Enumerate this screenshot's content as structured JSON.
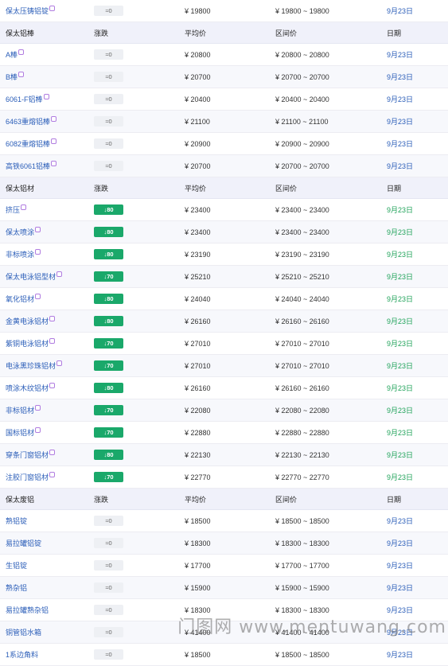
{
  "watermark": "门图网 www.mentuwang.com",
  "rows": [
    {
      "type": "data",
      "name": "保太压铸铝锭",
      "mark": true,
      "change": "0",
      "up": false,
      "avg": "¥  19800",
      "range": "¥  19800 ~ 19800",
      "date": "9月23日",
      "green": false
    },
    {
      "type": "head",
      "c1": "保太铝棒",
      "c2": "涨跌",
      "c3": "平均价",
      "c4": "区间价",
      "c5": "日期"
    },
    {
      "type": "data",
      "name": "A棒",
      "mark": true,
      "change": "0",
      "up": false,
      "avg": "¥  20800",
      "range": "¥  20800 ~ 20800",
      "date": "9月23日",
      "green": false
    },
    {
      "type": "data",
      "name": "B棒",
      "mark": true,
      "change": "0",
      "up": false,
      "avg": "¥  20700",
      "range": "¥  20700 ~ 20700",
      "date": "9月23日",
      "green": false
    },
    {
      "type": "data",
      "name": "6061-F铝棒",
      "mark": true,
      "change": "0",
      "up": false,
      "avg": "¥  20400",
      "range": "¥  20400 ~ 20400",
      "date": "9月23日",
      "green": false
    },
    {
      "type": "data",
      "name": "6463重熔铝棒",
      "mark": true,
      "change": "0",
      "up": false,
      "avg": "¥  21100",
      "range": "¥  21100 ~ 21100",
      "date": "9月23日",
      "green": false
    },
    {
      "type": "data",
      "name": "6082重熔铝棒",
      "mark": true,
      "change": "0",
      "up": false,
      "avg": "¥  20900",
      "range": "¥  20900 ~ 20900",
      "date": "9月23日",
      "green": false
    },
    {
      "type": "data",
      "name": "高铁6061铝棒",
      "mark": true,
      "change": "0",
      "up": false,
      "avg": "¥  20700",
      "range": "¥  20700 ~ 20700",
      "date": "9月23日",
      "green": false
    },
    {
      "type": "head",
      "c1": "保太铝材",
      "c2": "涨跌",
      "c3": "平均价",
      "c4": "区间价",
      "c5": "日期"
    },
    {
      "type": "data",
      "name": "挤压",
      "mark": true,
      "change": "80",
      "up": true,
      "avg": "¥  23400",
      "range": "¥  23400 ~ 23400",
      "date": "9月23日",
      "green": true
    },
    {
      "type": "data",
      "name": "保太喷涂",
      "mark": true,
      "change": "80",
      "up": true,
      "avg": "¥  23400",
      "range": "¥  23400 ~ 23400",
      "date": "9月23日",
      "green": true
    },
    {
      "type": "data",
      "name": "非标喷涂",
      "mark": true,
      "change": "80",
      "up": true,
      "avg": "¥  23190",
      "range": "¥  23190 ~ 23190",
      "date": "9月23日",
      "green": true
    },
    {
      "type": "data",
      "name": "保太电泳铝型材",
      "mark": true,
      "change": "70",
      "up": true,
      "avg": "¥  25210",
      "range": "¥  25210 ~ 25210",
      "date": "9月23日",
      "green": true
    },
    {
      "type": "data",
      "name": "氧化铝材",
      "mark": true,
      "change": "80",
      "up": true,
      "avg": "¥  24040",
      "range": "¥  24040 ~ 24040",
      "date": "9月23日",
      "green": true
    },
    {
      "type": "data",
      "name": "金黄电泳铝材",
      "mark": true,
      "change": "80",
      "up": true,
      "avg": "¥  26160",
      "range": "¥  26160 ~ 26160",
      "date": "9月23日",
      "green": true
    },
    {
      "type": "data",
      "name": "紫铜电泳铝材",
      "mark": true,
      "change": "70",
      "up": true,
      "avg": "¥  27010",
      "range": "¥  27010 ~ 27010",
      "date": "9月23日",
      "green": true
    },
    {
      "type": "data",
      "name": "电泳黑珍珠铝材",
      "mark": true,
      "change": "70",
      "up": true,
      "avg": "¥  27010",
      "range": "¥  27010 ~ 27010",
      "date": "9月23日",
      "green": true
    },
    {
      "type": "data",
      "name": "喷涂木纹铝材",
      "mark": true,
      "change": "80",
      "up": true,
      "avg": "¥  26160",
      "range": "¥  26160 ~ 26160",
      "date": "9月23日",
      "green": true
    },
    {
      "type": "data",
      "name": "非标铝材",
      "mark": true,
      "change": "70",
      "up": true,
      "avg": "¥  22080",
      "range": "¥  22080 ~ 22080",
      "date": "9月23日",
      "green": true
    },
    {
      "type": "data",
      "name": "国标铝材",
      "mark": true,
      "change": "70",
      "up": true,
      "avg": "¥  22880",
      "range": "¥  22880 ~ 22880",
      "date": "9月23日",
      "green": true
    },
    {
      "type": "data",
      "name": "穿条门窗铝材",
      "mark": true,
      "change": "80",
      "up": true,
      "avg": "¥  22130",
      "range": "¥  22130 ~ 22130",
      "date": "9月23日",
      "green": true
    },
    {
      "type": "data",
      "name": "注胶门窗铝材",
      "mark": true,
      "change": "70",
      "up": true,
      "avg": "¥  22770",
      "range": "¥  22770 ~ 22770",
      "date": "9月23日",
      "green": true
    },
    {
      "type": "head",
      "c1": "保太废铝",
      "c2": "涨跌",
      "c3": "平均价",
      "c4": "区间价",
      "c5": "日期"
    },
    {
      "type": "data",
      "name": "熟铝锭",
      "mark": false,
      "change": "0",
      "up": false,
      "avg": "¥  18500",
      "range": "¥  18500 ~ 18500",
      "date": "9月23日",
      "green": false
    },
    {
      "type": "data",
      "name": "易拉罐铝锭",
      "mark": false,
      "change": "0",
      "up": false,
      "avg": "¥  18300",
      "range": "¥  18300 ~ 18300",
      "date": "9月23日",
      "green": false
    },
    {
      "type": "data",
      "name": "生铝锭",
      "mark": false,
      "change": "0",
      "up": false,
      "avg": "¥  17700",
      "range": "¥  17700 ~ 17700",
      "date": "9月23日",
      "green": false
    },
    {
      "type": "data",
      "name": "熟杂铝",
      "mark": false,
      "change": "0",
      "up": false,
      "avg": "¥  15900",
      "range": "¥  15900 ~ 15900",
      "date": "9月23日",
      "green": false
    },
    {
      "type": "data",
      "name": "易拉罐熟杂铝",
      "mark": false,
      "change": "0",
      "up": false,
      "avg": "¥  18300",
      "range": "¥  18300 ~ 18300",
      "date": "9月23日",
      "green": false
    },
    {
      "type": "data",
      "name": "铜管铝水箱",
      "mark": false,
      "change": "0",
      "up": false,
      "avg": "¥  41400",
      "range": "¥  41400 ~ 41400",
      "date": "9月23日",
      "green": false
    },
    {
      "type": "data",
      "name": "1系边角料",
      "mark": false,
      "change": "0",
      "up": false,
      "avg": "¥  18500",
      "range": "¥  18500 ~ 18500",
      "date": "9月23日",
      "green": false
    }
  ]
}
